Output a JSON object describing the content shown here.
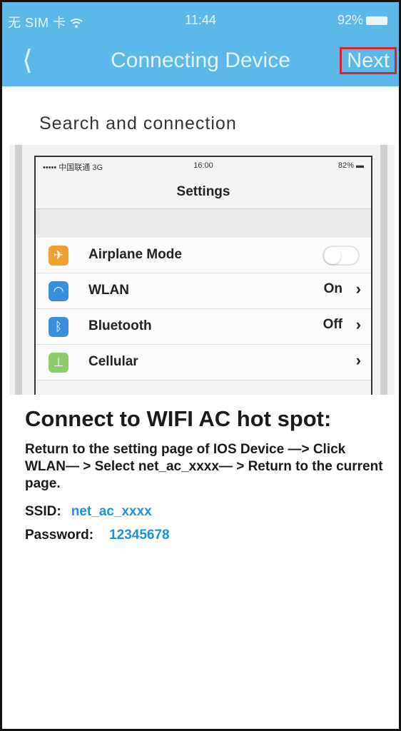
{
  "status_bar": {
    "carrier": "无 SIM 卡 ",
    "wifi_icon": "wifi-icon",
    "time": "11:44",
    "battery": "92%"
  },
  "nav": {
    "back_icon": "chevron-left-icon",
    "title": "Connecting Device",
    "next_label": "Next",
    "accent": "#5cb8e8",
    "highlight": "#d6242c"
  },
  "section_title": "Search and connection",
  "phone": {
    "status": {
      "carrier": "••••• 中国联通  3G",
      "time": "16:00",
      "battery": "82%"
    },
    "title": "Settings",
    "rows": [
      {
        "label": "Airplane Mode",
        "icon": "airplane-icon",
        "color": "#f0a030",
        "value": "",
        "toggle": true
      },
      {
        "label": "WLAN",
        "icon": "wifi-icon",
        "color": "#3a8fdc",
        "value": "On",
        "toggle": false
      },
      {
        "label": "Bluetooth",
        "icon": "bluetooth-icon",
        "color": "#3a8fdc",
        "value": "Off",
        "toggle": false
      },
      {
        "label": "Cellular",
        "icon": "cellular-icon",
        "color": "#8ccc6a",
        "value": "",
        "toggle": false
      }
    ]
  },
  "instructions": {
    "title": "Connect to WIFI AC hot spot:",
    "text": "Return to the setting page of IOS Device —> Click WLAN— > Select net_ac_xxxx— > Return to the current page.",
    "ssid_label": "SSID:",
    "ssid_value": "net_ac_xxxx",
    "password_label": "Password:",
    "password_value": "12345678",
    "value_color": "#1c93d5"
  }
}
